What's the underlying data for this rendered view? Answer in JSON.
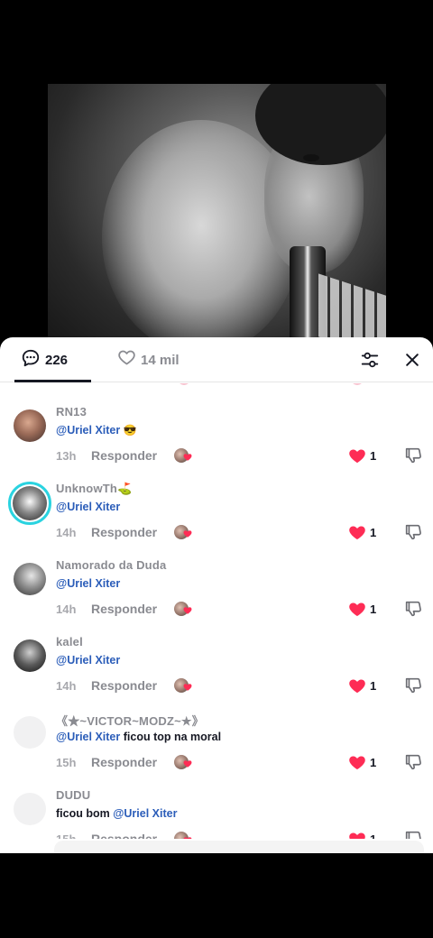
{
  "header": {
    "comments_count": "226",
    "likes_count": "14 mil"
  },
  "comments": [
    {
      "username": "RN13",
      "mention": "@Uriel Xiter",
      "text": "",
      "emoji": "😎",
      "time": "13h",
      "reply_label": "Responder",
      "likes": "1"
    },
    {
      "username": "UnknowTh⛳",
      "mention": "@Uriel Xiter",
      "text": "",
      "emoji": "",
      "time": "14h",
      "reply_label": "Responder",
      "likes": "1"
    },
    {
      "username": "Namorado da Duda",
      "mention": "@Uriel Xiter",
      "text": "",
      "emoji": "",
      "time": "14h",
      "reply_label": "Responder",
      "likes": "1"
    },
    {
      "username": "kalel",
      "mention": "@Uriel Xiter",
      "text": "",
      "emoji": "",
      "time": "14h",
      "reply_label": "Responder",
      "likes": "1"
    },
    {
      "username": "《★~VICTOR~MODZ~★》",
      "mention": "@Uriel Xiter",
      "text": "ficou top na moral",
      "emoji": "",
      "time": "15h",
      "reply_label": "Responder",
      "likes": "1"
    },
    {
      "username": "DUDU",
      "prefix": "ficou bom",
      "mention": "@Uriel Xiter",
      "text": "",
      "emoji": "",
      "time": "15h",
      "reply_label": "Responder",
      "likes": "1"
    }
  ],
  "colors": {
    "like_red": "#fe2c55",
    "mention_blue": "#2b5db9",
    "story_ring": "#2ad3e0"
  }
}
